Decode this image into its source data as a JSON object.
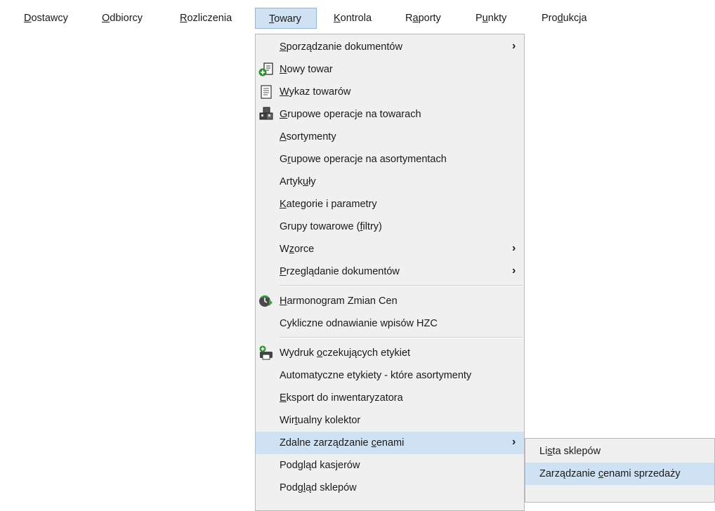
{
  "menubar": {
    "items": [
      {
        "label": "Dostawcy",
        "hot": "D"
      },
      {
        "label": "Odbiorcy",
        "hot": "O"
      },
      {
        "label": "Rozliczenia",
        "hot": "R"
      },
      {
        "label": "Towary",
        "hot": "T"
      },
      {
        "label": "Kontrola",
        "hot": "K"
      },
      {
        "label": "Raporty",
        "hot": "a"
      },
      {
        "label": "Punkty",
        "hot": "u"
      },
      {
        "label": "Produkcja",
        "hot": "d"
      }
    ],
    "active_index": 3
  },
  "towary_menu": {
    "items": [
      {
        "label": "Sporządzanie dokumentów",
        "hot": "S",
        "submenu": true,
        "icon": ""
      },
      {
        "label": "Nowy towar",
        "hot": "N",
        "icon": "new-product-icon"
      },
      {
        "label": "Wykaz towarów",
        "hot": "W",
        "icon": "product-list-icon"
      },
      {
        "label": "Grupowe operacje na towarach",
        "hot": "G",
        "icon": "group-operations-icon"
      },
      {
        "label": "Asortymenty",
        "hot": "A"
      },
      {
        "label": "Grupowe operacje na asortymentach",
        "hot": "r"
      },
      {
        "label": "Artykuły",
        "hot": "u"
      },
      {
        "label": "Kategorie i parametry",
        "hot": "K"
      },
      {
        "label": "Grupy towarowe (filtry)",
        "hot": "f"
      },
      {
        "label": "Wzorce",
        "hot": "z",
        "submenu": true
      },
      {
        "label": "Przeglądanie dokumentów",
        "hot": "P",
        "submenu": true,
        "separator_after": true
      },
      {
        "label": "Harmonogram Zmian Cen",
        "hot": "H",
        "icon": "price-schedule-icon"
      },
      {
        "label": "Cykliczne odnawianie wpisów HZC",
        "hot": "",
        "separator_after": true
      },
      {
        "label": "Wydruk oczekujących etykiet",
        "hot": "o",
        "icon": "label-printer-icon"
      },
      {
        "label": "Automatyczne etykiety - które asortymenty",
        "hot": ""
      },
      {
        "label": "Eksport do inwentaryzatora",
        "hot": "E"
      },
      {
        "label": "Wirtualny kolektor",
        "hot": "t"
      },
      {
        "label": "Zdalne zarządzanie cenami",
        "hot": "c",
        "submenu": true,
        "highlighted": true
      },
      {
        "label": "Podgląd kasjerów",
        "hot": ""
      },
      {
        "label": "Podgląd sklepów",
        "hot": "l"
      }
    ]
  },
  "submenu": {
    "items": [
      {
        "label": "Lista sklepów",
        "hot": "s"
      },
      {
        "label": "Zarządzanie cenami sprzedaży",
        "hot": "c",
        "highlighted": true
      }
    ]
  },
  "arrow_glyph": "›",
  "colors": {
    "highlight": "#cfe2f4",
    "highlight_border": "#8fb4d6",
    "menu_bg": "#f0f0f0"
  }
}
